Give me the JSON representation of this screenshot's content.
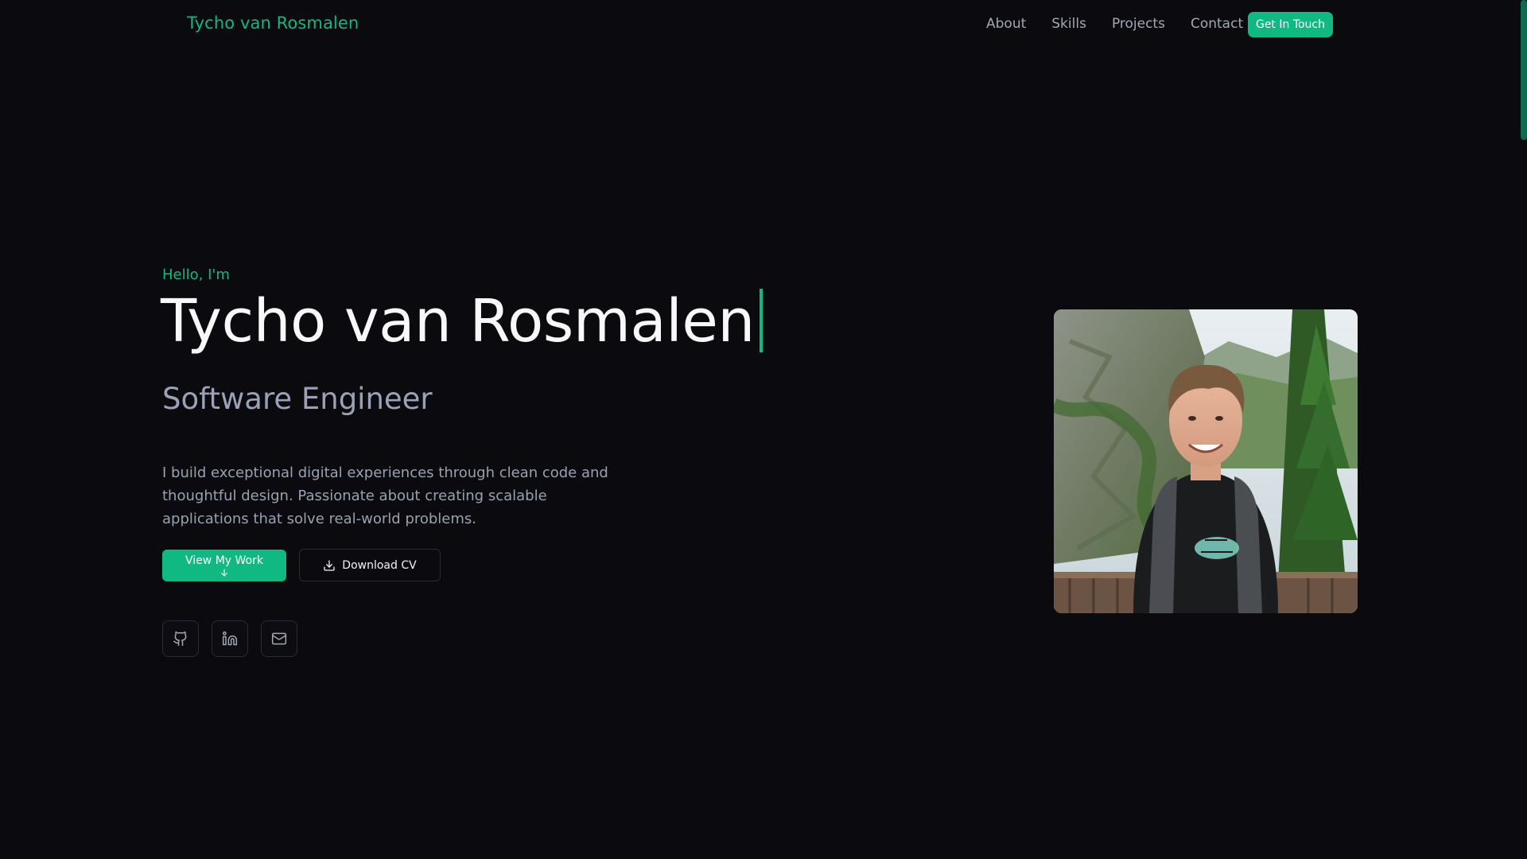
{
  "header": {
    "brand": "Tycho van Rosmalen",
    "nav": [
      {
        "label": "About"
      },
      {
        "label": "Skills"
      },
      {
        "label": "Projects"
      },
      {
        "label": "Contact"
      }
    ],
    "cta_label": "Get In Touch"
  },
  "hero": {
    "greeting": "Hello, I'm",
    "name": "Tycho van Rosmalen",
    "role": "Software Engineer",
    "description": "I build exceptional digital experiences through clean code and thoughtful design. Passionate about creating scalable applications that solve real-world problems.",
    "primary_button": "View My Work",
    "primary_button_icon": "arrow-down-icon",
    "secondary_button": "Download CV",
    "secondary_button_icon": "download-icon",
    "socials": [
      {
        "icon": "github-icon"
      },
      {
        "icon": "linkedin-icon"
      },
      {
        "icon": "mail-icon"
      }
    ]
  },
  "photo": {
    "subject": "portrait-photo"
  },
  "colors": {
    "accent": "#10b981",
    "background": "#0a0a0f",
    "text_primary": "#f8f8fb",
    "text_muted": "#9aa1b4"
  }
}
